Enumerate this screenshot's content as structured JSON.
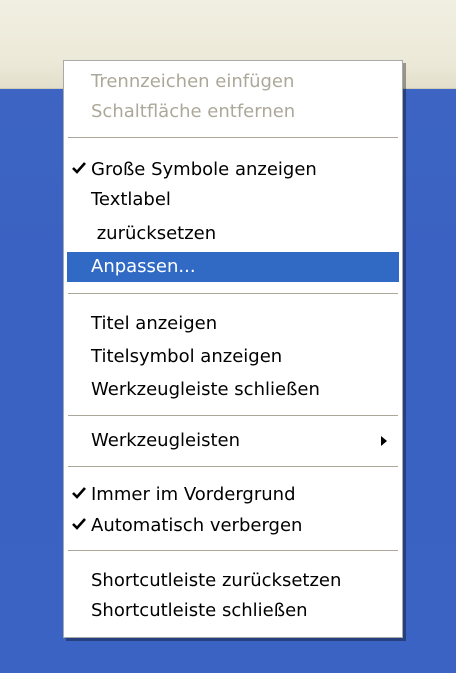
{
  "menu": {
    "items": [
      {
        "label": "Trennzeichen einfügen",
        "state": "disabled"
      },
      {
        "label": "Schaltfläche entfernen",
        "state": "disabled"
      },
      {
        "label": "Große Symbole anzeigen",
        "checked": true
      },
      {
        "label": "Textlabel"
      },
      {
        "label": " zurücksetzen"
      },
      {
        "label": "Anpassen...",
        "state": "highlighted"
      },
      {
        "label": "Titel anzeigen"
      },
      {
        "label": "Titelsymbol anzeigen"
      },
      {
        "label": "Werkzeugleiste schließen"
      },
      {
        "label": "Werkzeugleisten",
        "submenu": true
      },
      {
        "label": "Immer im Vordergrund",
        "checked": true
      },
      {
        "label": "Automatisch verbergen",
        "checked": true
      },
      {
        "label": "Shortcutleiste zurücksetzen"
      },
      {
        "label": "Shortcutleiste schließen"
      }
    ]
  },
  "colors": {
    "highlight": "#316ac5",
    "disabled_text": "#aca899",
    "desktop": "#3a62c2",
    "topbar": "#ece9d8"
  }
}
